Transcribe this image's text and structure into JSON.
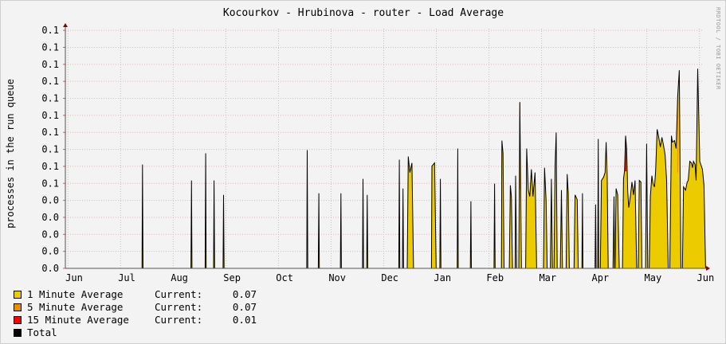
{
  "chart_data": {
    "type": "area",
    "title": "Kocourkov - Hrubinova - router - Load Average",
    "ylabel": "processes in the run queue",
    "watermark": "RRDTOOL / TOBI OETIKER",
    "x_ticks": [
      "Jun",
      "Jul",
      "Aug",
      "Sep",
      "Oct",
      "Nov",
      "Dec",
      "Jan",
      "Feb",
      "Mar",
      "Apr",
      "May",
      "Jun"
    ],
    "y_ticks": [
      "0.0",
      "0.0",
      "0.0",
      "0.0",
      "0.0",
      "0.1",
      "0.1",
      "0.1",
      "0.1",
      "0.1",
      "0.1",
      "0.1",
      "0.1",
      "0.1",
      "0.1"
    ],
    "ylim": [
      0,
      0.15
    ],
    "grid": true,
    "series": [
      {
        "name": "1 Minute Average",
        "current": "0.07"
      },
      {
        "name": "5 Minute Average",
        "current": "0.07"
      },
      {
        "name": "15 Minute Average",
        "current": "0.01"
      },
      {
        "name": "Total",
        "current": ""
      }
    ],
    "current_label": "Current:",
    "colors": {
      "one_min": "#eccc00",
      "five_min": "#ea8f00",
      "fifteen_min": "#ff0000",
      "total": "#000000",
      "grid_minor": "#e3b5b5",
      "axis": "#8b0000"
    },
    "points": [
      [
        0.03,
        0.0
      ],
      [
        0.3,
        0.0
      ],
      [
        1.0,
        0.0
      ],
      [
        1.29,
        0.0
      ],
      [
        1.3,
        0.065
      ],
      [
        1.31,
        0.0
      ],
      [
        2.22,
        0.0
      ],
      [
        2.23,
        0.055
      ],
      [
        2.24,
        0.0
      ],
      [
        2.49,
        0.0
      ],
      [
        2.5,
        0.072
      ],
      [
        2.51,
        0.0
      ],
      [
        2.65,
        0.0
      ],
      [
        2.66,
        0.055
      ],
      [
        2.67,
        0.0
      ],
      [
        2.83,
        0.0
      ],
      [
        2.84,
        0.046
      ],
      [
        2.85,
        0.0
      ],
      [
        4.42,
        0.0
      ],
      [
        4.43,
        0.074
      ],
      [
        4.44,
        0.0
      ],
      [
        4.64,
        0.0
      ],
      [
        4.65,
        0.047
      ],
      [
        4.66,
        0.0
      ],
      [
        5.06,
        0.0
      ],
      [
        5.07,
        0.047
      ],
      [
        5.08,
        0.0
      ],
      [
        5.48,
        0.0
      ],
      [
        5.49,
        0.056
      ],
      [
        5.5,
        0.0
      ],
      [
        5.56,
        0.0
      ],
      [
        5.57,
        0.046
      ],
      [
        5.58,
        0.0
      ],
      [
        6.17,
        0.0
      ],
      [
        6.18,
        0.068
      ],
      [
        6.19,
        0.0
      ],
      [
        6.24,
        0.0
      ],
      [
        6.25,
        0.05
      ],
      [
        6.26,
        0.0
      ],
      [
        6.33,
        0.0
      ],
      [
        6.35,
        0.07
      ],
      [
        6.38,
        0.06
      ],
      [
        6.42,
        0.066
      ],
      [
        6.45,
        0.0
      ],
      [
        6.79,
        0.0
      ],
      [
        6.8,
        0.064
      ],
      [
        6.85,
        0.066
      ],
      [
        6.88,
        0.0
      ],
      [
        6.95,
        0.0
      ],
      [
        6.96,
        0.056
      ],
      [
        6.97,
        0.0
      ],
      [
        7.28,
        0.0
      ],
      [
        7.29,
        0.075
      ],
      [
        7.3,
        0.0
      ],
      [
        7.53,
        0.0
      ],
      [
        7.54,
        0.042
      ],
      [
        7.55,
        0.0
      ],
      [
        7.98,
        0.0
      ],
      [
        7.99,
        0.053
      ],
      [
        8.0,
        0.0
      ],
      [
        8.12,
        0.0
      ],
      [
        8.13,
        0.08
      ],
      [
        8.15,
        0.072
      ],
      [
        8.17,
        0.0
      ],
      [
        8.27,
        0.0
      ],
      [
        8.29,
        0.052
      ],
      [
        8.31,
        0.045
      ],
      [
        8.33,
        0.0
      ],
      [
        8.38,
        0.0
      ],
      [
        8.39,
        0.058
      ],
      [
        8.41,
        0.0
      ],
      [
        8.45,
        0.0
      ],
      [
        8.47,
        0.104
      ],
      [
        8.5,
        0.0
      ],
      [
        8.58,
        0.0
      ],
      [
        8.6,
        0.075
      ],
      [
        8.63,
        0.049
      ],
      [
        8.66,
        0.045
      ],
      [
        8.69,
        0.062
      ],
      [
        8.72,
        0.045
      ],
      [
        8.76,
        0.06
      ],
      [
        8.79,
        0.0
      ],
      [
        8.92,
        0.0
      ],
      [
        8.94,
        0.063
      ],
      [
        8.97,
        0.042
      ],
      [
        8.99,
        0.0
      ],
      [
        9.05,
        0.0
      ],
      [
        9.07,
        0.056
      ],
      [
        9.09,
        0.0
      ],
      [
        9.12,
        0.0
      ],
      [
        9.14,
        0.064
      ],
      [
        9.16,
        0.085
      ],
      [
        9.18,
        0.0
      ],
      [
        9.24,
        0.0
      ],
      [
        9.26,
        0.049
      ],
      [
        9.28,
        0.0
      ],
      [
        9.35,
        0.0
      ],
      [
        9.37,
        0.059
      ],
      [
        9.39,
        0.047
      ],
      [
        9.41,
        0.0
      ],
      [
        9.5,
        0.0
      ],
      [
        9.52,
        0.046
      ],
      [
        9.56,
        0.043
      ],
      [
        9.58,
        0.0
      ],
      [
        9.65,
        0.0
      ],
      [
        9.66,
        0.047
      ],
      [
        9.67,
        0.0
      ],
      [
        9.9,
        0.0
      ],
      [
        9.91,
        0.04
      ],
      [
        9.92,
        0.0
      ],
      [
        9.95,
        0.0
      ],
      [
        9.96,
        0.081
      ],
      [
        9.97,
        0.0
      ],
      [
        10.0,
        0.0
      ],
      [
        10.02,
        0.055
      ],
      [
        10.06,
        0.057
      ],
      [
        10.09,
        0.06
      ],
      [
        10.11,
        0.079
      ],
      [
        10.13,
        0.058
      ],
      [
        10.15,
        0.0
      ],
      [
        10.24,
        0.0
      ],
      [
        10.26,
        0.045
      ],
      [
        10.27,
        0.0
      ],
      [
        10.28,
        0.0
      ],
      [
        10.3,
        0.05
      ],
      [
        10.33,
        0.046
      ],
      [
        10.36,
        0.0
      ],
      [
        10.42,
        0.0
      ],
      [
        10.44,
        0.056
      ],
      [
        10.46,
        0.061
      ],
      [
        10.48,
        0.083
      ],
      [
        10.5,
        0.075
      ],
      [
        10.52,
        0.048
      ],
      [
        10.54,
        0.038
      ],
      [
        10.57,
        0.045
      ],
      [
        10.6,
        0.054
      ],
      [
        10.63,
        0.046
      ],
      [
        10.66,
        0.055
      ],
      [
        10.69,
        0.0
      ],
      [
        10.72,
        0.0
      ],
      [
        10.74,
        0.055
      ],
      [
        10.77,
        0.054
      ],
      [
        10.79,
        0.0
      ],
      [
        10.86,
        0.0
      ],
      [
        10.88,
        0.078
      ],
      [
        10.9,
        0.0
      ],
      [
        10.93,
        0.0
      ],
      [
        10.95,
        0.045
      ],
      [
        10.98,
        0.058
      ],
      [
        11.0,
        0.053
      ],
      [
        11.03,
        0.051
      ],
      [
        11.05,
        0.061
      ],
      [
        11.08,
        0.087
      ],
      [
        11.11,
        0.082
      ],
      [
        11.14,
        0.076
      ],
      [
        11.17,
        0.082
      ],
      [
        11.2,
        0.077
      ],
      [
        11.23,
        0.071
      ],
      [
        11.26,
        0.055
      ],
      [
        11.29,
        0.0
      ],
      [
        11.32,
        0.0
      ],
      [
        11.35,
        0.083
      ],
      [
        11.37,
        0.079
      ],
      [
        11.41,
        0.08
      ],
      [
        11.44,
        0.075
      ],
      [
        11.47,
        0.108
      ],
      [
        11.5,
        0.124
      ],
      [
        11.53,
        0.0
      ],
      [
        11.56,
        0.0
      ],
      [
        11.58,
        0.051
      ],
      [
        11.62,
        0.049
      ],
      [
        11.65,
        0.054
      ],
      [
        11.67,
        0.055
      ],
      [
        11.7,
        0.067
      ],
      [
        11.73,
        0.066
      ],
      [
        11.75,
        0.063
      ],
      [
        11.77,
        0.067
      ],
      [
        11.8,
        0.065
      ],
      [
        11.82,
        0.055
      ],
      [
        11.85,
        0.125
      ],
      [
        11.89,
        0.067
      ],
      [
        11.94,
        0.062
      ],
      [
        11.97,
        0.052
      ],
      [
        12.0,
        0.0
      ]
    ]
  }
}
